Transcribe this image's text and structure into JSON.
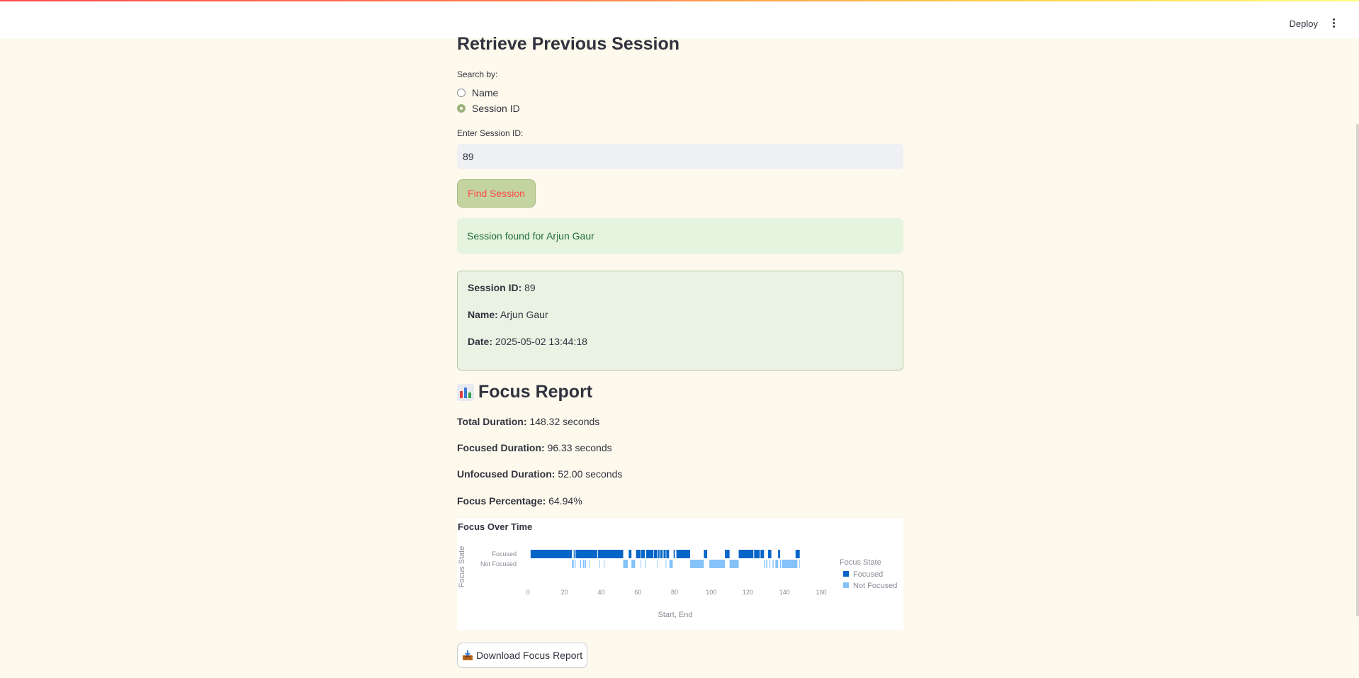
{
  "header": {
    "deploy_label": "Deploy",
    "menu_icon": "kebab-menu-icon"
  },
  "page": {
    "title": "Retrieve Previous Session",
    "search_by_label": "Search by:",
    "radio_options": [
      {
        "label": "Name",
        "checked": false
      },
      {
        "label": "Session ID",
        "checked": true
      }
    ],
    "session_id_label": "Enter Session ID:",
    "session_id_value": "89",
    "find_button": "Find Session",
    "success_message": "Session found for Arjun Gaur"
  },
  "session": {
    "id_label": "Session ID:",
    "id_value": "89",
    "name_label": "Name:",
    "name_value": "Arjun Gaur",
    "date_label": "Date:",
    "date_value": "2025-05-02 13:44:18"
  },
  "report": {
    "title": "Focus Report",
    "icon": "bar-chart-icon",
    "stats": [
      {
        "label": "Total Duration:",
        "value": "148.32 seconds"
      },
      {
        "label": "Focused Duration:",
        "value": "96.33 seconds"
      },
      {
        "label": "Unfocused Duration:",
        "value": "52.00 seconds"
      },
      {
        "label": "Focus Percentage:",
        "value": "64.94%"
      }
    ],
    "download_button": "Download Focus Report"
  },
  "chart_data": {
    "type": "bar",
    "subtype": "timeline",
    "title": "Focus Over Time",
    "xlabel": "Start, End",
    "ylabel": "Focus State",
    "categories": [
      "Focused",
      "Not Focused"
    ],
    "xlim": [
      0,
      160
    ],
    "xticks": [
      0,
      20,
      40,
      60,
      80,
      100,
      120,
      140,
      160
    ],
    "legend_title": "Focus State",
    "legend_position": "right",
    "grid": false,
    "series": [
      {
        "name": "Focused",
        "color": "#0565c8",
        "intervals": [
          [
            1.5,
            24
          ],
          [
            25,
            25.5
          ],
          [
            26,
            37.8
          ],
          [
            38.2,
            52
          ],
          [
            55,
            56.5
          ],
          [
            59,
            61.5
          ],
          [
            61.8,
            63.8
          ],
          [
            64.5,
            68.5
          ],
          [
            68.8,
            70.5
          ],
          [
            70.9,
            71.8
          ],
          [
            72.2,
            73.5
          ],
          [
            74,
            75.2
          ],
          [
            75.5,
            77
          ],
          [
            79.5,
            80.2
          ],
          [
            81,
            88.5
          ],
          [
            96,
            97.8
          ],
          [
            107.5,
            110
          ],
          [
            115,
            123
          ],
          [
            123.4,
            126.5
          ],
          [
            126.9,
            128.8
          ],
          [
            131,
            132.8
          ],
          [
            136.5,
            137.6
          ],
          [
            146,
            148.3
          ]
        ]
      },
      {
        "name": "Not Focused",
        "color": "#85c2f8",
        "intervals": [
          [
            24,
            25
          ],
          [
            25.5,
            26
          ],
          [
            28.5,
            29
          ],
          [
            30,
            30.8
          ],
          [
            31.2,
            31.7
          ],
          [
            33.5,
            33.8
          ],
          [
            39,
            39.2
          ],
          [
            41.5,
            41.8
          ],
          [
            52,
            54.5
          ],
          [
            56.5,
            58.5
          ],
          [
            61.5,
            61.8
          ],
          [
            63.8,
            64.2
          ],
          [
            70.5,
            70.8
          ],
          [
            75.2,
            75.5
          ],
          [
            77.2,
            79
          ],
          [
            88.5,
            96
          ],
          [
            99,
            107.5
          ],
          [
            110,
            115
          ],
          [
            128.8,
            129.3
          ],
          [
            130,
            130.6
          ],
          [
            131.8,
            132.2
          ],
          [
            133.5,
            134
          ],
          [
            135,
            136.5
          ],
          [
            137.5,
            138
          ],
          [
            138.5,
            147
          ],
          [
            148,
            148.3
          ]
        ]
      }
    ]
  }
}
